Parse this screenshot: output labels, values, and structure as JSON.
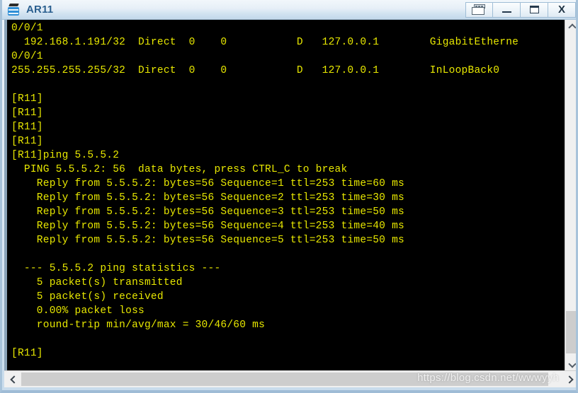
{
  "window": {
    "title": "AR11",
    "app_icon": "router-icon",
    "buttons": [
      {
        "name": "window-group-button",
        "icon": "restore-group-icon",
        "label": ""
      },
      {
        "name": "minimize-button",
        "icon": "minimize-icon",
        "label": "—"
      },
      {
        "name": "maximize-button",
        "icon": "maximize-icon",
        "label": ""
      },
      {
        "name": "close-button",
        "icon": "close-icon",
        "label": "X"
      }
    ],
    "colors": {
      "titlebar_gradient_top": "#f2f7fb",
      "titlebar_gradient_bottom": "#c2d8ea",
      "title_text": "#2a5f8f",
      "frame_border": "#a8c3da",
      "terminal_background": "#000000",
      "terminal_text": "#e8e800",
      "scrollbar_track": "#f0f0f0",
      "scrollbar_thumb": "#cdcdcd"
    }
  },
  "terminal": {
    "lines": [
      "0/0/1",
      "  192.168.1.191/32  Direct  0    0           D   127.0.0.1        GigabitEtherne",
      "0/0/1",
      "255.255.255.255/32  Direct  0    0           D   127.0.0.1        InLoopBack0",
      "",
      "[R11]",
      "[R11]",
      "[R11]",
      "[R11]",
      "[R11]ping 5.5.5.2",
      "  PING 5.5.5.2: 56  data bytes, press CTRL_C to break",
      "    Reply from 5.5.5.2: bytes=56 Sequence=1 ttl=253 time=60 ms",
      "    Reply from 5.5.5.2: bytes=56 Sequence=2 ttl=253 time=30 ms",
      "    Reply from 5.5.5.2: bytes=56 Sequence=3 ttl=253 time=50 ms",
      "    Reply from 5.5.5.2: bytes=56 Sequence=4 ttl=253 time=40 ms",
      "    Reply from 5.5.5.2: bytes=56 Sequence=5 ttl=253 time=50 ms",
      "",
      "  --- 5.5.5.2 ping statistics ---",
      "    5 packet(s) transmitted",
      "    5 packet(s) received",
      "    0.00% packet loss",
      "    round-trip min/avg/max = 30/46/60 ms",
      "",
      "[R11]"
    ],
    "prompt": "[R11]",
    "command": "ping 5.5.5.2",
    "ping_target": "5.5.5.2",
    "ping_stats": {
      "transmitted": "5 packet(s) transmitted",
      "received": "5 packet(s) received",
      "loss": "0.00% packet loss",
      "round_trip": "round-trip min/avg/max = 30/46/60 ms"
    }
  },
  "scrollbars": {
    "vertical": {
      "up_icon": "chevron-up-icon",
      "down_icon": "chevron-down-icon",
      "thumb_position_percent": 86
    },
    "horizontal": {
      "left_icon": "chevron-left-icon",
      "right_icon": "chevron-right-icon",
      "thumb_position_percent": 0
    }
  },
  "watermark": {
    "text": "https://blog.csdn.net/wwwyyh"
  }
}
